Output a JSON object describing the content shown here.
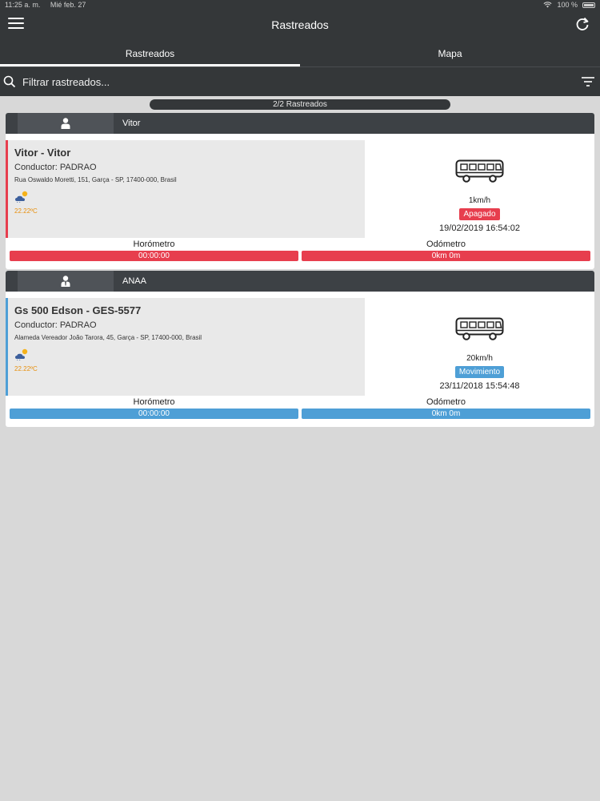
{
  "status_bar": {
    "time": "11:25 a. m.",
    "date": "Mié feb. 27",
    "battery": "100 %"
  },
  "header": {
    "title": "Rastreados"
  },
  "tabs": [
    {
      "label": "Rastreados"
    },
    {
      "label": "Mapa"
    }
  ],
  "search": {
    "placeholder": "Filtrar rastreados..."
  },
  "count": "2/2 Rastreados",
  "colors": {
    "bar_dark": "#343739",
    "red": "#e73e4e",
    "blue": "#4e9fd6",
    "temp": "#e8900e"
  },
  "cards": [
    {
      "group": "Vitor",
      "group_icon": "person-icon",
      "vehicle": "Vitor - Vitor",
      "driver": "Conductor: PADRAO",
      "address": "Rua Oswaldo Moretti, 151, Garça - SP, 17400-000, Brasil",
      "temperature": "22.22ºC",
      "speed": "1km/h",
      "status": "Apagado",
      "datetime": "19/02/2019 16:54:02",
      "horometro_label": "Horómetro",
      "horometro": "00:00:00",
      "odometro_label": "Odómetro",
      "odometro": "0km 0m",
      "color": "#e73e4e"
    },
    {
      "group": "ANAA",
      "group_icon": "business-person-icon",
      "vehicle": "Gs 500 Edson - GES-5577",
      "driver": "Conductor: PADRAO",
      "address": "Alameda Vereador João Tarora, 45, Garça - SP, 17400-000, Brasil",
      "temperature": "22.22ºC",
      "speed": "20km/h",
      "status": "Movimiento",
      "datetime": "23/11/2018 15:54:48",
      "horometro_label": "Horómetro",
      "horometro": "00:00:00",
      "odometro_label": "Odómetro",
      "odometro": "0km 0m",
      "color": "#4e9fd6"
    }
  ]
}
